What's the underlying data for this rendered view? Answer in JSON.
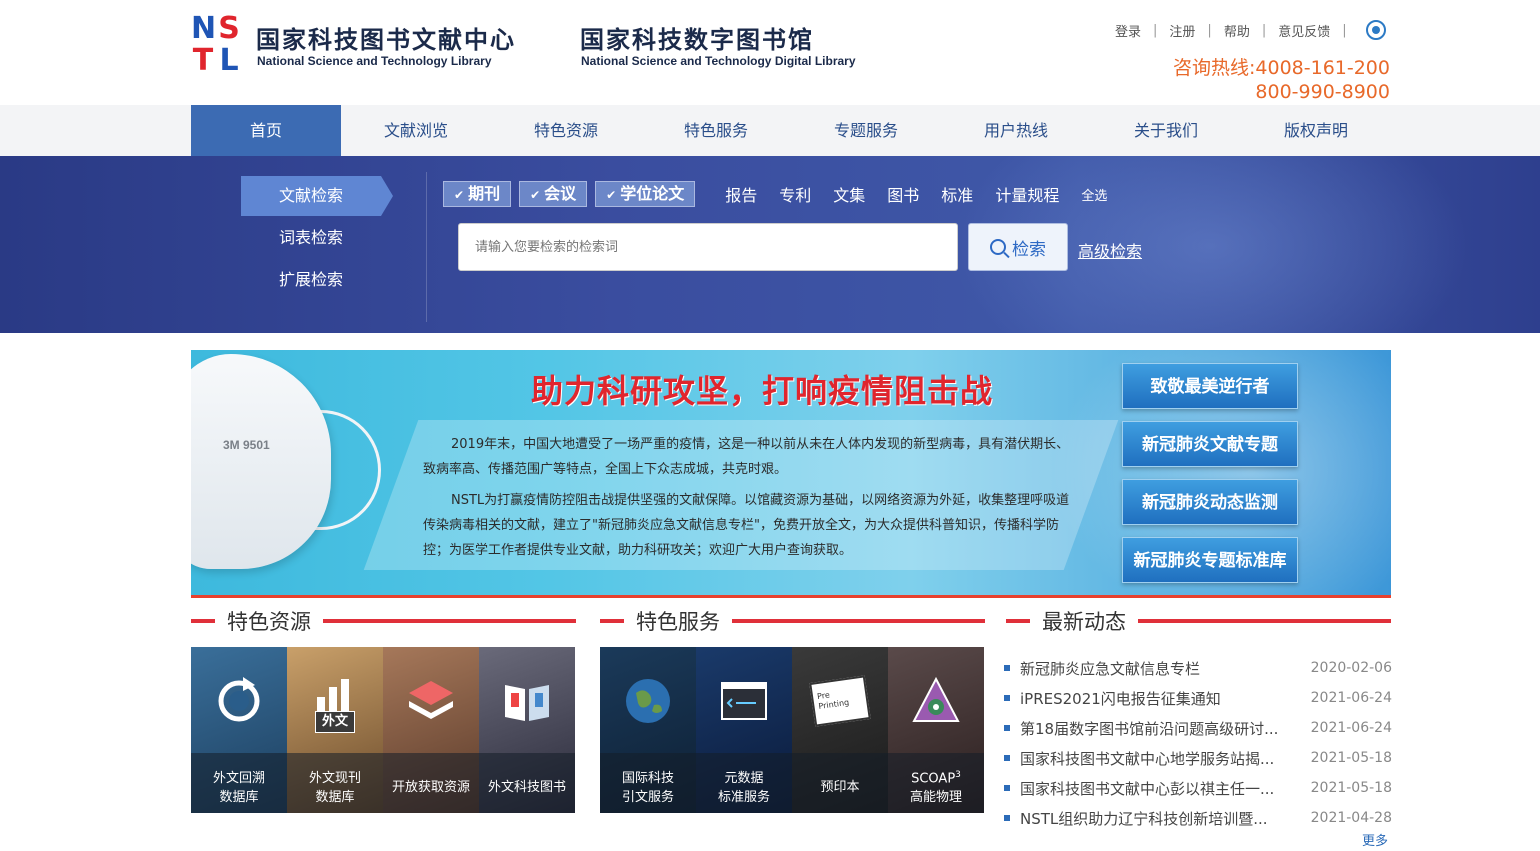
{
  "header": {
    "logo_letters": [
      "N",
      "S",
      "T",
      "L"
    ],
    "title_cn_1": "国家科技图书文献中心",
    "title_en_1": "National Science and Technology Library",
    "title_cn_2": "国家科技数字图书馆",
    "title_en_2": "National Science and Technology Digital Library",
    "links": [
      "登录",
      "注册",
      "帮助",
      "意见反馈"
    ],
    "hotline_label": "咨询热线:",
    "hotline_1": "4008-161-200",
    "hotline_2": "800-990-8900"
  },
  "nav": [
    "首页",
    "文献浏览",
    "特色资源",
    "特色服务",
    "专题服务",
    "用户热线",
    "关于我们",
    "版权声明"
  ],
  "search": {
    "tabs": [
      "文献检索",
      "词表检索",
      "扩展检索"
    ],
    "checked_types": [
      "期刊",
      "会议",
      "学位论文"
    ],
    "other_types": [
      "报告",
      "专利",
      "文集",
      "图书",
      "标准",
      "计量规程"
    ],
    "select_all": "全选",
    "placeholder": "请输入您要检索的检索词",
    "button": "检索",
    "advanced": "高级检索"
  },
  "banner": {
    "title": "助力科研攻坚，打响疫情阻击战",
    "mask_label": "3M 9501",
    "para1": "2019年末，中国大地遭受了一场严重的疫情，这是一种以前从未在人体内发现的新型病毒，具有潜伏期长、致病率高、传播范围广等特点，全国上下众志成城，共克时艰。",
    "para2": "NSTL为打赢疫情防控阻击战提供坚强的文献保障。以馆藏资源为基础，以网络资源为外延，收集整理呼吸道传染病毒相关的文献，建立了\"新冠肺炎应急文献信息专栏\"，免费开放全文，为大众提供科普知识，传播科学防控；为医学工作者提供专业文献，助力科研攻关；欢迎广大用户查询获取。",
    "buttons": [
      "致敬最美逆行者",
      "新冠肺炎文献专题",
      "新冠肺炎动态监测",
      "新冠肺炎专题标准库"
    ]
  },
  "sections": {
    "resources": "特色资源",
    "services": "特色服务",
    "news": "最新动态"
  },
  "resources": [
    {
      "l1": "外文回溯",
      "l2": "数据库"
    },
    {
      "l1": "外文现刊",
      "l2": "数据库",
      "badge": "外文"
    },
    {
      "l1": "开放获取资源",
      "l2": ""
    },
    {
      "l1": "外文科技图书",
      "l2": ""
    }
  ],
  "services": [
    {
      "l1": "国际科技",
      "l2": "引文服务"
    },
    {
      "l1": "元数据",
      "l2": "标准服务"
    },
    {
      "l1": "预印本",
      "l2": "",
      "badge": "Pre Printing"
    },
    {
      "l1": "SCOAP",
      "sup": "3",
      "l2": "高能物理"
    }
  ],
  "news": [
    {
      "title": "新冠肺炎应急文献信息专栏",
      "date": "2020-02-06"
    },
    {
      "title": "iPRES2021闪电报告征集通知",
      "date": "2021-06-24"
    },
    {
      "title": "第18届数字图书馆前沿问题高级研讨...",
      "date": "2021-06-24"
    },
    {
      "title": "国家科技图书文献中心地学服务站揭...",
      "date": "2021-05-18"
    },
    {
      "title": "国家科技图书文献中心彭以祺主任一...",
      "date": "2021-05-18"
    },
    {
      "title": "NSTL组织助力辽宁科技创新培训暨...",
      "date": "2021-04-28"
    }
  ],
  "more": "更多"
}
